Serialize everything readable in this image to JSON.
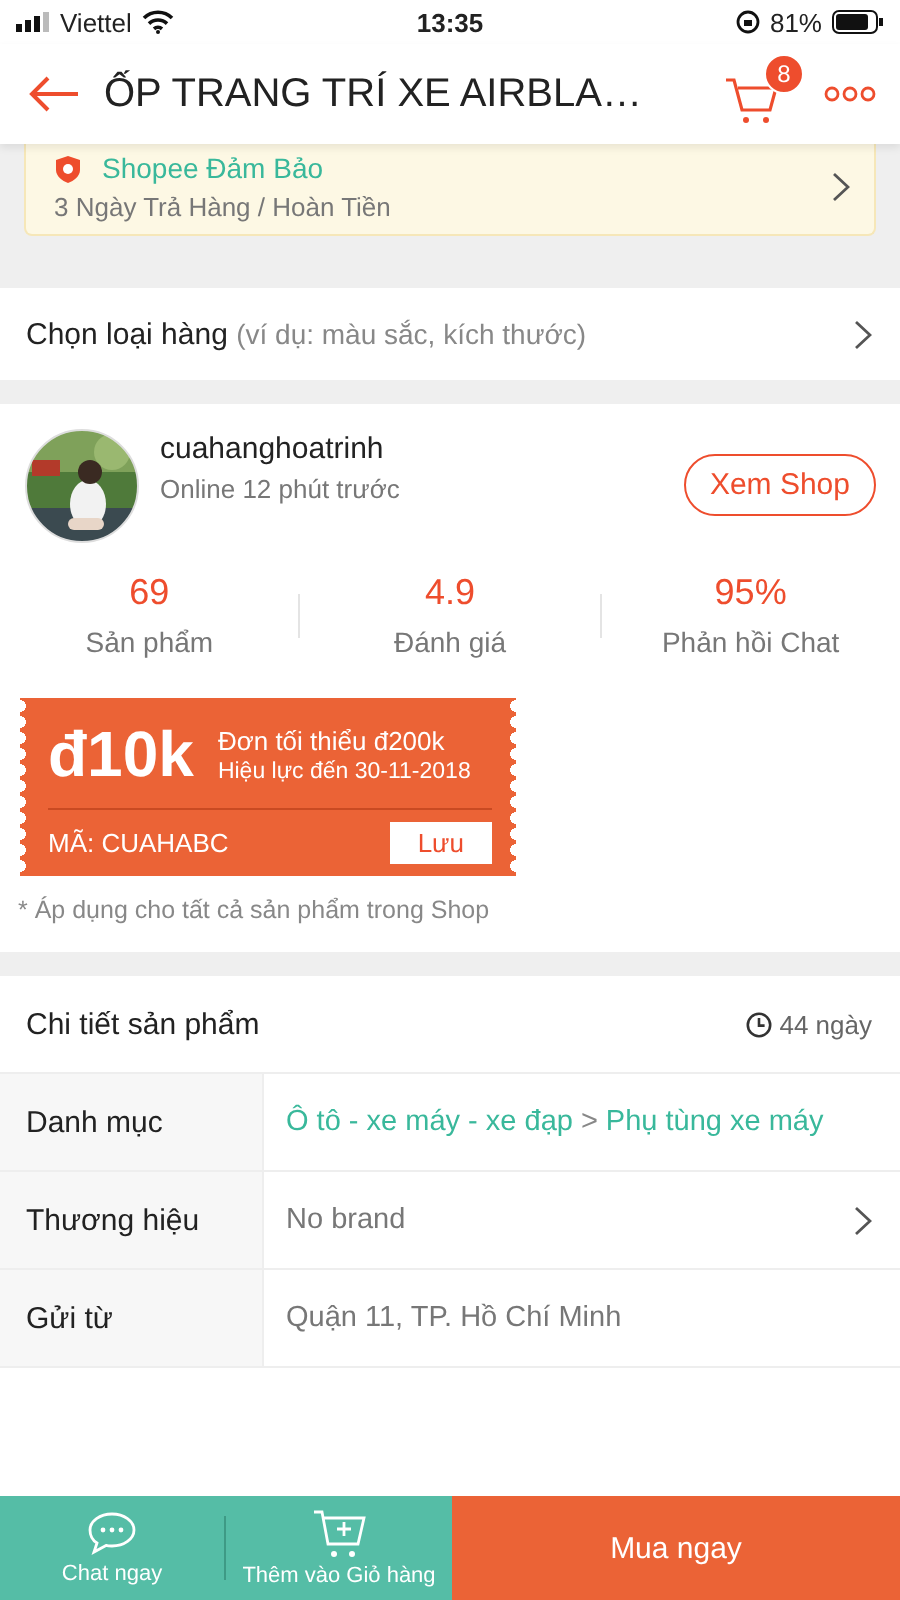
{
  "status_bar": {
    "carrier": "Viettel",
    "time": "13:35",
    "battery": "81%"
  },
  "header": {
    "title": "ỐP TRANG TRÍ XE AIRBLA…",
    "cart_count": "8"
  },
  "guarantee": {
    "title": "Shopee Đảm Bảo",
    "subtitle": "3 Ngày Trả Hàng / Hoàn Tiền"
  },
  "variant_row": {
    "label": "Chọn loại hàng",
    "hint": "(ví dụ: màu sắc, kích thước)"
  },
  "shop": {
    "name": "cuahanghoatrinh",
    "status": "Online 12 phút trước",
    "button": "Xem Shop",
    "stats": [
      {
        "value": "69",
        "label": "Sản phẩm"
      },
      {
        "value": "4.9",
        "label": "Đánh giá"
      },
      {
        "value": "95%",
        "label": "Phản hồi Chat"
      }
    ]
  },
  "voucher": {
    "amount": "đ10k",
    "min_order": "Đơn tối thiểu đ200k",
    "validity": "Hiệu lực đến 30-11-2018",
    "code": "MÃ: CUAHABC",
    "button": "Lưu",
    "note": "* Áp dụng cho tất cả sản phẩm trong Shop"
  },
  "details": {
    "title": "Chi tiết sản phẩm",
    "age": "44 ngày",
    "rows": [
      {
        "label": "Danh mục",
        "kind": "links",
        "links": [
          "Ô tô - xe máy - xe đạp",
          "Phụ tùng xe máy"
        ],
        "separator": ">"
      },
      {
        "label": "Thương hiệu",
        "kind": "chevron",
        "value": "No brand"
      },
      {
        "label": "Gửi từ",
        "kind": "plain",
        "value": "Quận 11, TP. Hồ Chí Minh"
      }
    ]
  },
  "bottom_bar": {
    "chat": "Chat ngay",
    "add_cart": "Thêm vào Giỏ hàng",
    "buy": "Mua ngay"
  }
}
